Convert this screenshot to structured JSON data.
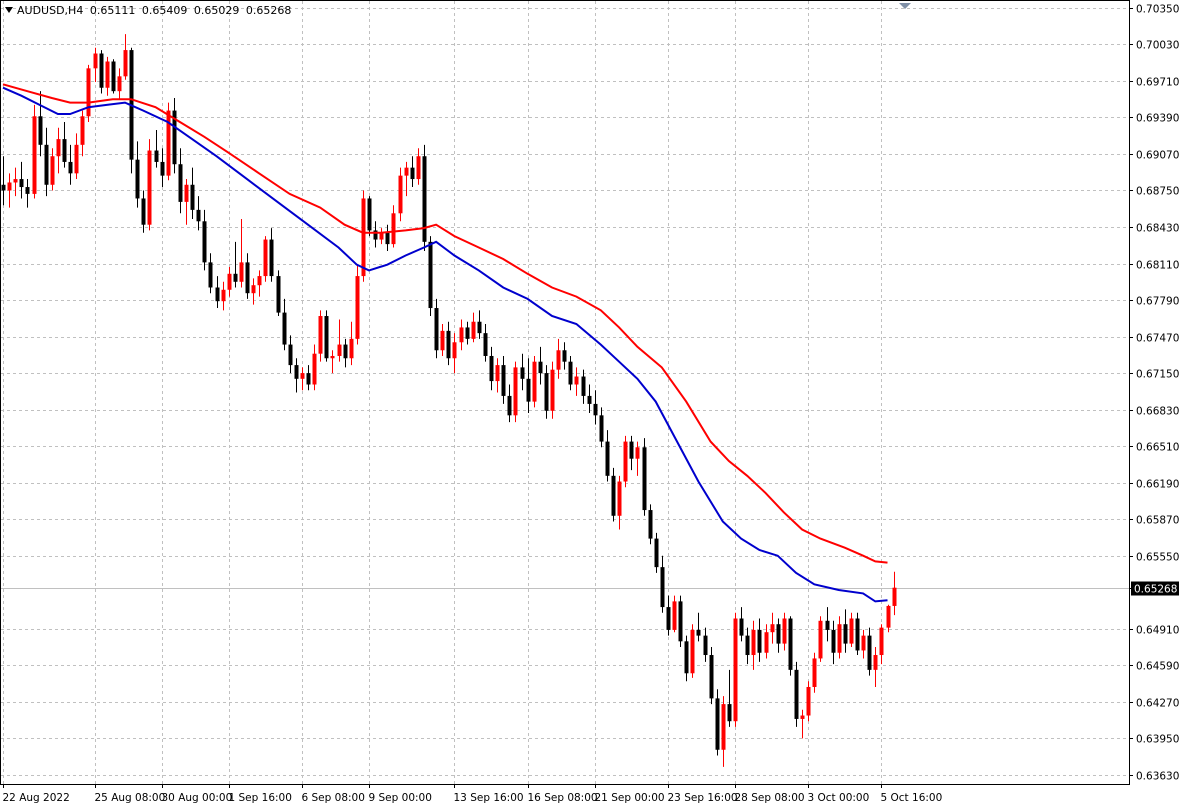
{
  "header": {
    "symbol": "AUDUSD,H4",
    "open": "0.65111",
    "high": "0.65409",
    "low": "0.65029",
    "close": "0.65268"
  },
  "current_price_label": "0.65268",
  "colors": {
    "bull": "#ff0000",
    "bear": "#000000",
    "ma_fast": "#0000cd",
    "ma_slow": "#ff0000",
    "grid": "#c0c0c0",
    "price_line": "#c0c0c0",
    "price_tag_bg": "#000000"
  },
  "chart_data": {
    "type": "candlestick",
    "symbol": "AUDUSD",
    "timeframe": "H4",
    "y_ticks": [
      "0.70350",
      "0.70030",
      "0.69710",
      "0.69390",
      "0.69070",
      "0.68750",
      "0.68430",
      "0.68110",
      "0.67790",
      "0.67470",
      "0.67150",
      "0.66830",
      "0.66510",
      "0.66190",
      "0.65870",
      "0.65550",
      "0.65268",
      "0.64910",
      "0.64590",
      "0.64270",
      "0.63950",
      "0.63630"
    ],
    "ylim": [
      0.6355,
      0.7041
    ],
    "x_labels": [
      "22 Aug 2022",
      "25 Aug 08:00",
      "30 Aug 00:00",
      "1 Sep 16:00",
      "6 Sep 08:00",
      "9 Sep 00:00",
      "13 Sep 16:00",
      "16 Sep 08:00",
      "21 Sep 00:00",
      "23 Sep 16:00",
      "28 Sep 08:00",
      "3 Oct 00:00",
      "5 Oct 16:00"
    ],
    "x_label_bar_index": [
      0,
      15,
      26,
      37,
      49,
      60,
      74,
      86,
      97,
      109,
      120,
      132,
      144
    ],
    "grid": true,
    "last_close": 0.65268,
    "candles": [
      [
        0.688,
        0.6905,
        0.6862,
        0.6875
      ],
      [
        0.6875,
        0.689,
        0.686,
        0.6882
      ],
      [
        0.6882,
        0.6895,
        0.687,
        0.6885
      ],
      [
        0.6885,
        0.69,
        0.6868,
        0.6878
      ],
      [
        0.6878,
        0.6885,
        0.686,
        0.6872
      ],
      [
        0.6872,
        0.695,
        0.6868,
        0.694
      ],
      [
        0.694,
        0.6962,
        0.6905,
        0.6915
      ],
      [
        0.6915,
        0.693,
        0.687,
        0.688
      ],
      [
        0.688,
        0.6912,
        0.6875,
        0.6905
      ],
      [
        0.6905,
        0.693,
        0.689,
        0.692
      ],
      [
        0.692,
        0.6935,
        0.6895,
        0.69
      ],
      [
        0.69,
        0.6915,
        0.688,
        0.689
      ],
      [
        0.689,
        0.6925,
        0.6885,
        0.6915
      ],
      [
        0.6915,
        0.6945,
        0.6905,
        0.694
      ],
      [
        0.694,
        0.6985,
        0.6935,
        0.6982
      ],
      [
        0.6982,
        0.7,
        0.697,
        0.6995
      ],
      [
        0.6995,
        0.6998,
        0.696,
        0.6965
      ],
      [
        0.6965,
        0.6992,
        0.6958,
        0.6988
      ],
      [
        0.6988,
        0.699,
        0.696,
        0.6962
      ],
      [
        0.6962,
        0.6982,
        0.6955,
        0.6975
      ],
      [
        0.6975,
        0.7012,
        0.6972,
        0.6998
      ],
      [
        0.6998,
        0.7,
        0.689,
        0.6902
      ],
      [
        0.6902,
        0.6918,
        0.686,
        0.6868
      ],
      [
        0.6868,
        0.6875,
        0.6838,
        0.6845
      ],
      [
        0.6845,
        0.692,
        0.684,
        0.691
      ],
      [
        0.691,
        0.6928,
        0.6895,
        0.69
      ],
      [
        0.69,
        0.6912,
        0.6878,
        0.6888
      ],
      [
        0.6888,
        0.6952,
        0.6884,
        0.6945
      ],
      [
        0.6945,
        0.6956,
        0.689,
        0.6898
      ],
      [
        0.6898,
        0.6912,
        0.6855,
        0.6865
      ],
      [
        0.6865,
        0.6885,
        0.6845,
        0.688
      ],
      [
        0.688,
        0.6895,
        0.685,
        0.6858
      ],
      [
        0.6858,
        0.687,
        0.684,
        0.6848
      ],
      [
        0.6848,
        0.6858,
        0.6805,
        0.6812
      ],
      [
        0.6812,
        0.682,
        0.6785,
        0.679
      ],
      [
        0.679,
        0.68,
        0.6772,
        0.6778
      ],
      [
        0.6778,
        0.6795,
        0.677,
        0.6788
      ],
      [
        0.6788,
        0.6808,
        0.6782,
        0.6802
      ],
      [
        0.6802,
        0.683,
        0.679,
        0.6795
      ],
      [
        0.6795,
        0.685,
        0.679,
        0.6812
      ],
      [
        0.6812,
        0.682,
        0.678,
        0.6785
      ],
      [
        0.6785,
        0.6798,
        0.6775,
        0.6792
      ],
      [
        0.6792,
        0.6805,
        0.6782,
        0.68
      ],
      [
        0.68,
        0.6835,
        0.6795,
        0.6832
      ],
      [
        0.6832,
        0.6842,
        0.6795,
        0.68
      ],
      [
        0.68,
        0.6805,
        0.6765,
        0.6768
      ],
      [
        0.6768,
        0.678,
        0.6735,
        0.674
      ],
      [
        0.674,
        0.6748,
        0.6715,
        0.6722
      ],
      [
        0.6722,
        0.6728,
        0.6698,
        0.671
      ],
      [
        0.671,
        0.672,
        0.67,
        0.6715
      ],
      [
        0.6715,
        0.6722,
        0.67,
        0.6705
      ],
      [
        0.6705,
        0.674,
        0.67,
        0.6732
      ],
      [
        0.6732,
        0.677,
        0.6725,
        0.6765
      ],
      [
        0.6765,
        0.677,
        0.6725,
        0.6728
      ],
      [
        0.6728,
        0.6735,
        0.6715,
        0.673
      ],
      [
        0.673,
        0.6762,
        0.6725,
        0.674
      ],
      [
        0.674,
        0.6745,
        0.672,
        0.6728
      ],
      [
        0.6728,
        0.676,
        0.6722,
        0.6745
      ],
      [
        0.6745,
        0.681,
        0.674,
        0.68
      ],
      [
        0.68,
        0.6875,
        0.6795,
        0.6868
      ],
      [
        0.6868,
        0.687,
        0.6835,
        0.684
      ],
      [
        0.684,
        0.6848,
        0.6825,
        0.6832
      ],
      [
        0.6832,
        0.6842,
        0.6828,
        0.6838
      ],
      [
        0.6838,
        0.6845,
        0.6822,
        0.6828
      ],
      [
        0.6828,
        0.6862,
        0.6825,
        0.6855
      ],
      [
        0.6855,
        0.6895,
        0.6848,
        0.6888
      ],
      [
        0.6888,
        0.69,
        0.687,
        0.6895
      ],
      [
        0.6895,
        0.6905,
        0.6878,
        0.6885
      ],
      [
        0.6885,
        0.6912,
        0.688,
        0.6905
      ],
      [
        0.6905,
        0.6915,
        0.6822,
        0.683
      ],
      [
        0.683,
        0.6835,
        0.6765,
        0.6772
      ],
      [
        0.6772,
        0.678,
        0.6728,
        0.6735
      ],
      [
        0.6735,
        0.6758,
        0.673,
        0.6752
      ],
      [
        0.6752,
        0.676,
        0.6722,
        0.6728
      ],
      [
        0.6728,
        0.675,
        0.6715,
        0.6742
      ],
      [
        0.6742,
        0.6762,
        0.6735,
        0.6755
      ],
      [
        0.6755,
        0.676,
        0.674,
        0.6745
      ],
      [
        0.6745,
        0.6768,
        0.6742,
        0.676
      ],
      [
        0.676,
        0.677,
        0.6745,
        0.675
      ],
      [
        0.675,
        0.6758,
        0.6725,
        0.673
      ],
      [
        0.673,
        0.6738,
        0.67,
        0.6708
      ],
      [
        0.6708,
        0.6728,
        0.6698,
        0.6722
      ],
      [
        0.6722,
        0.673,
        0.6688,
        0.6695
      ],
      [
        0.6695,
        0.6705,
        0.6672,
        0.6678
      ],
      [
        0.6678,
        0.6725,
        0.6672,
        0.672
      ],
      [
        0.672,
        0.6732,
        0.67,
        0.671
      ],
      [
        0.671,
        0.6728,
        0.668,
        0.669
      ],
      [
        0.669,
        0.673,
        0.6685,
        0.6725
      ],
      [
        0.6725,
        0.6738,
        0.6705,
        0.6715
      ],
      [
        0.6715,
        0.6722,
        0.6675,
        0.6682
      ],
      [
        0.6682,
        0.6725,
        0.6675,
        0.6718
      ],
      [
        0.6718,
        0.6745,
        0.671,
        0.6735
      ],
      [
        0.6735,
        0.6742,
        0.6718,
        0.6725
      ],
      [
        0.6725,
        0.673,
        0.67,
        0.6705
      ],
      [
        0.6705,
        0.672,
        0.6695,
        0.6712
      ],
      [
        0.6712,
        0.6718,
        0.6688,
        0.6695
      ],
      [
        0.6695,
        0.6705,
        0.668,
        0.6688
      ],
      [
        0.6688,
        0.67,
        0.667,
        0.6678
      ],
      [
        0.6678,
        0.6685,
        0.665,
        0.6655
      ],
      [
        0.6655,
        0.6665,
        0.662,
        0.6625
      ],
      [
        0.6625,
        0.6632,
        0.6585,
        0.659
      ],
      [
        0.659,
        0.6625,
        0.6578,
        0.662
      ],
      [
        0.662,
        0.666,
        0.6615,
        0.6655
      ],
      [
        0.6655,
        0.666,
        0.663,
        0.664
      ],
      [
        0.664,
        0.6655,
        0.6625,
        0.665
      ],
      [
        0.665,
        0.6658,
        0.659,
        0.6595
      ],
      [
        0.6595,
        0.66,
        0.6565,
        0.657
      ],
      [
        0.657,
        0.6575,
        0.654,
        0.6545
      ],
      [
        0.6545,
        0.6555,
        0.6505,
        0.651
      ],
      [
        0.651,
        0.652,
        0.6485,
        0.649
      ],
      [
        0.649,
        0.652,
        0.6488,
        0.6515
      ],
      [
        0.6515,
        0.652,
        0.6475,
        0.648
      ],
      [
        0.648,
        0.6485,
        0.6445,
        0.6452
      ],
      [
        0.6452,
        0.6495,
        0.6448,
        0.649
      ],
      [
        0.649,
        0.6505,
        0.648,
        0.6485
      ],
      [
        0.6485,
        0.6492,
        0.6462,
        0.6468
      ],
      [
        0.6468,
        0.6475,
        0.6425,
        0.643
      ],
      [
        0.643,
        0.6438,
        0.638,
        0.6385
      ],
      [
        0.6385,
        0.6432,
        0.637,
        0.6425
      ],
      [
        0.6425,
        0.6455,
        0.6405,
        0.641
      ],
      [
        0.641,
        0.6505,
        0.6405,
        0.65
      ],
      [
        0.65,
        0.651,
        0.648,
        0.6485
      ],
      [
        0.6485,
        0.6492,
        0.646,
        0.6468
      ],
      [
        0.6468,
        0.6498,
        0.6455,
        0.649
      ],
      [
        0.649,
        0.65,
        0.6462,
        0.647
      ],
      [
        0.647,
        0.6495,
        0.6465,
        0.6488
      ],
      [
        0.6488,
        0.6505,
        0.6478,
        0.6495
      ],
      [
        0.6495,
        0.65,
        0.647,
        0.6478
      ],
      [
        0.6478,
        0.6505,
        0.6472,
        0.65
      ],
      [
        0.65,
        0.6502,
        0.645,
        0.6455
      ],
      [
        0.6455,
        0.6462,
        0.6405,
        0.6412
      ],
      [
        0.6412,
        0.642,
        0.6395,
        0.6415
      ],
      [
        0.6415,
        0.6445,
        0.641,
        0.644
      ],
      [
        0.644,
        0.647,
        0.6435,
        0.6465
      ],
      [
        0.6465,
        0.6502,
        0.6462,
        0.6498
      ],
      [
        0.6498,
        0.651,
        0.648,
        0.649
      ],
      [
        0.649,
        0.6498,
        0.646,
        0.647
      ],
      [
        0.647,
        0.6502,
        0.6465,
        0.6495
      ],
      [
        0.6495,
        0.6508,
        0.647,
        0.6478
      ],
      [
        0.6478,
        0.6505,
        0.6475,
        0.65
      ],
      [
        0.65,
        0.6505,
        0.6468,
        0.6472
      ],
      [
        0.6472,
        0.649,
        0.6465,
        0.6485
      ],
      [
        0.6485,
        0.6492,
        0.645,
        0.6455
      ],
      [
        0.6455,
        0.6475,
        0.644,
        0.6468
      ],
      [
        0.6468,
        0.6495,
        0.646,
        0.6492
      ],
      [
        0.6492,
        0.6512,
        0.6488,
        0.6511
      ],
      [
        0.6511,
        0.6541,
        0.6503,
        0.6527
      ]
    ],
    "ma_fast": [
      [
        0,
        0.6965
      ],
      [
        3,
        0.6958
      ],
      [
        6,
        0.695
      ],
      [
        9,
        0.6942
      ],
      [
        11,
        0.6942
      ],
      [
        14,
        0.6948
      ],
      [
        17,
        0.695
      ],
      [
        20,
        0.6952
      ],
      [
        23,
        0.6945
      ],
      [
        27,
        0.6935
      ],
      [
        31,
        0.692
      ],
      [
        35,
        0.6905
      ],
      [
        40,
        0.6885
      ],
      [
        45,
        0.6865
      ],
      [
        50,
        0.6845
      ],
      [
        55,
        0.6825
      ],
      [
        58,
        0.681
      ],
      [
        60,
        0.6805
      ],
      [
        63,
        0.681
      ],
      [
        66,
        0.6818
      ],
      [
        69,
        0.6825
      ],
      [
        71,
        0.683
      ],
      [
        74,
        0.6818
      ],
      [
        78,
        0.6805
      ],
      [
        82,
        0.679
      ],
      [
        86,
        0.678
      ],
      [
        90,
        0.6765
      ],
      [
        94,
        0.6758
      ],
      [
        98,
        0.674
      ],
      [
        101,
        0.6725
      ],
      [
        104,
        0.671
      ],
      [
        107,
        0.669
      ],
      [
        110,
        0.666
      ],
      [
        114,
        0.662
      ],
      [
        118,
        0.6585
      ],
      [
        121,
        0.657
      ],
      [
        124,
        0.656
      ],
      [
        127,
        0.6555
      ],
      [
        130,
        0.654
      ],
      [
        133,
        0.653
      ],
      [
        137,
        0.6525
      ],
      [
        141,
        0.6522
      ],
      [
        143,
        0.6515
      ],
      [
        145,
        0.6516
      ]
    ],
    "ma_slow": [
      [
        0,
        0.6968
      ],
      [
        4,
        0.6962
      ],
      [
        8,
        0.6956
      ],
      [
        11,
        0.6952
      ],
      [
        14,
        0.6952
      ],
      [
        18,
        0.6955
      ],
      [
        21,
        0.6955
      ],
      [
        25,
        0.6948
      ],
      [
        29,
        0.6935
      ],
      [
        33,
        0.6922
      ],
      [
        37,
        0.6908
      ],
      [
        42,
        0.689
      ],
      [
        47,
        0.6872
      ],
      [
        52,
        0.686
      ],
      [
        56,
        0.6845
      ],
      [
        59,
        0.6838
      ],
      [
        62,
        0.6838
      ],
      [
        66,
        0.684
      ],
      [
        69,
        0.6842
      ],
      [
        71,
        0.6845
      ],
      [
        74,
        0.6835
      ],
      [
        78,
        0.6825
      ],
      [
        82,
        0.6815
      ],
      [
        86,
        0.6802
      ],
      [
        90,
        0.679
      ],
      [
        94,
        0.6782
      ],
      [
        98,
        0.677
      ],
      [
        101,
        0.6755
      ],
      [
        104,
        0.6738
      ],
      [
        108,
        0.672
      ],
      [
        112,
        0.669
      ],
      [
        116,
        0.6655
      ],
      [
        119,
        0.6638
      ],
      [
        122,
        0.6625
      ],
      [
        125,
        0.661
      ],
      [
        128,
        0.6593
      ],
      [
        131,
        0.6578
      ],
      [
        134,
        0.657
      ],
      [
        138,
        0.6562
      ],
      [
        141,
        0.6555
      ],
      [
        143,
        0.655
      ],
      [
        145,
        0.6549
      ]
    ]
  }
}
